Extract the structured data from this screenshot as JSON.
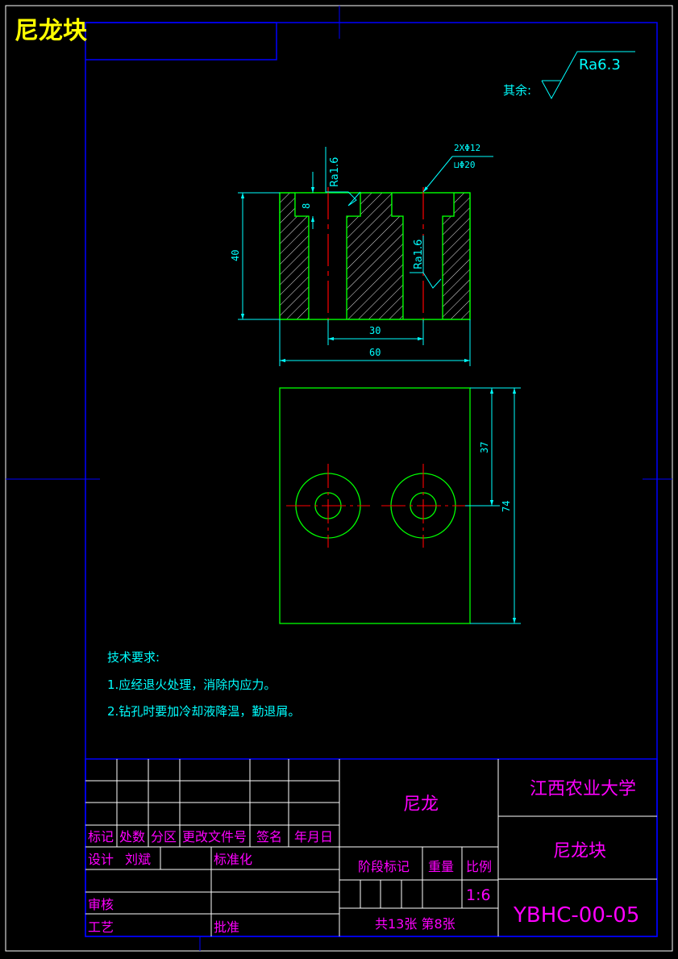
{
  "drawing_title": "尼龙块",
  "surface_finish": {
    "other_label": "其余:",
    "default_value": "Ra6.3",
    "counterbore_note": "Ra1.6",
    "bore_note": "Ra1.6"
  },
  "hole_callout": {
    "count_dia": "2XΦ12",
    "counterbore": "⊔Φ20"
  },
  "dimensions": {
    "height": "40",
    "counterbore_depth": "8",
    "hole_spacing": "30",
    "width": "60",
    "center_offset": "37",
    "length": "74"
  },
  "colors": {
    "background": "#000000",
    "frame": "#0000ff",
    "outline": "#00ff00",
    "dimension": "#00ffff",
    "centerline": "#ff0000",
    "title_text": "#ffff00",
    "table_text": "#ff00ff"
  },
  "technical_requirements": {
    "heading": "技术要求:",
    "items": [
      "1.应经退火处理，消除内应力。",
      "2.钻孔时要加冷却液降温，勤退屑。"
    ]
  },
  "title_block": {
    "revision_headers": {
      "mark": "标记",
      "count": "处数",
      "zone": "分区",
      "change_doc": "更改文件号",
      "signature": "签名",
      "date": "年月日"
    },
    "design_label": "设计",
    "designer": "刘斌",
    "standardization_label": "标准化",
    "review_label": "审核",
    "process_label": "工艺",
    "approve_label": "批准",
    "material": "尼龙",
    "stage_mark_label": "阶段标记",
    "weight_label": "重量",
    "scale_label": "比例",
    "scale_value": "1:6",
    "sheet_info": "共13张  第8张",
    "organization": "江西农业大学",
    "part_name": "尼龙块",
    "drawing_number": "YBHC-00-05"
  }
}
